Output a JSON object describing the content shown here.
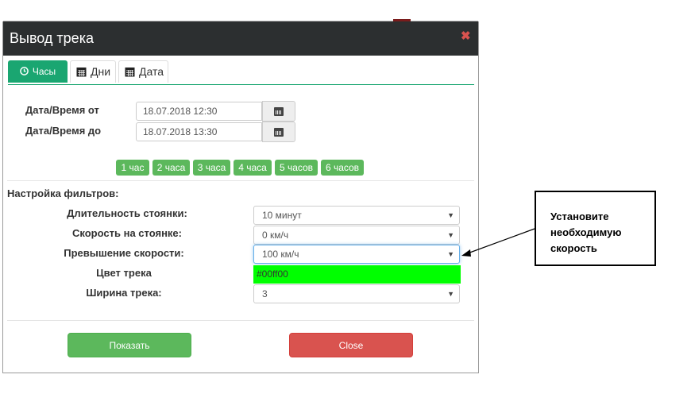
{
  "window": {
    "title": "Вывод трека",
    "close_glyph": "✖"
  },
  "tabs": [
    {
      "label": "Часы",
      "icon": "clock-icon",
      "active": true
    },
    {
      "label": "Дни",
      "icon": "calendar-icon",
      "active": false
    },
    {
      "label": "Дата",
      "icon": "calendar-icon",
      "active": false
    }
  ],
  "period": {
    "from_label": "Дата/Время от",
    "from_value": "18.07.2018 12:30",
    "to_label": "Дата/Время до",
    "to_value": "18.07.2018 13:30"
  },
  "quick_ranges": [
    "1 час",
    "2 часа",
    "3 часа",
    "4 часа",
    "5 часов",
    "6 часов"
  ],
  "filters": {
    "heading": "Настройка фильтров:",
    "stop_duration_label": "Длительность стоянки:",
    "stop_duration_value": "10 минут",
    "stop_speed_label": "Скорость на стоянке:",
    "stop_speed_value": "0 км/ч",
    "overspeed_label": "Превышение скорости:",
    "overspeed_value": "100 км/ч",
    "track_color_label": "Цвет трека",
    "track_color_value": "#00ff00",
    "track_width_label": "Ширина трека:",
    "track_width_value": "3"
  },
  "actions": {
    "show_label": "Показать",
    "close_label": "Close"
  },
  "annotation": {
    "line1": "Установите",
    "line2": "необходимую",
    "line3": "скорость"
  },
  "colors": {
    "accent": "#1aa671",
    "success": "#5cb85c",
    "danger": "#d9534f",
    "titlebar": "#2c2f30",
    "track_color": "#00ff00"
  }
}
